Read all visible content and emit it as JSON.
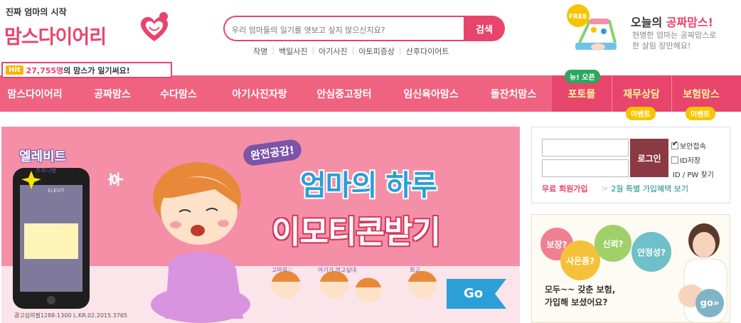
{
  "header": {
    "tagline": "진짜 엄마의 시작",
    "logo_text": "맘스다이어리",
    "search": {
      "placeholder": "우리 엄마들의 일기를 엿보고 싶지 않으신지요?",
      "button_label": "검색"
    },
    "keywords": [
      "작명",
      "백일사진",
      "아기사진",
      "아토피증상",
      "산후다이어트"
    ],
    "promo": {
      "badge": "FREE",
      "title_prefix": "오늘의 ",
      "title_highlight": "공짜맘스!",
      "description": "현명한 엄마는 공짜맘스로 한 살림 장만해요!"
    },
    "hit": {
      "tag": "Hit",
      "count": "27,755명",
      "suffix": "의 맘스가 일기써요!"
    }
  },
  "nav": {
    "items": [
      "맘스다이어리",
      "공짜맘스",
      "수다맘스",
      "아기사진자랑",
      "안심중고장터",
      "임신육아맘스",
      "돌잔치맘스"
    ],
    "right_items": [
      "포토몰",
      "재무상담",
      "보험맘스"
    ],
    "badges": {
      "new_open": "뉴! 오픈",
      "event_1": "이벤트",
      "event_2": "이벤트"
    }
  },
  "banner": {
    "brand": "엘레비트",
    "brand_sub": "프로나탈",
    "tag": "완전공감!",
    "title": "엄마의 하루",
    "subtitle": "이모티콘받기",
    "exclaim": "후",
    "phone_label": "ELEVIT",
    "mini_labels": [
      "고마워♡",
      "아기가 먹고싶대",
      "최고"
    ],
    "go_label": "Go",
    "approval_note": "광고심의필1288-1300 L.KR.02.2015.3765"
  },
  "login": {
    "button_label": "로그인",
    "secure_label": "보안접속",
    "save_id_label": "ID저장",
    "find_label": "ID / PW 찾기",
    "join_label": "무료 회원가입",
    "event_link": "2월 특별 가입혜택 보기"
  },
  "side_ad": {
    "bubbles": [
      "보장?",
      "사은품?",
      "신뢰?",
      "안정성?"
    ],
    "text_line1": "모두~~ 갖춘 보험,",
    "text_line2": "가입해 보셨어요?",
    "go_label": "go»"
  },
  "colors": {
    "brand_pink": "#e8456c",
    "nav_pink": "#ef6380",
    "banner_pink": "#f58fa7",
    "login_button": "#8b3943"
  }
}
